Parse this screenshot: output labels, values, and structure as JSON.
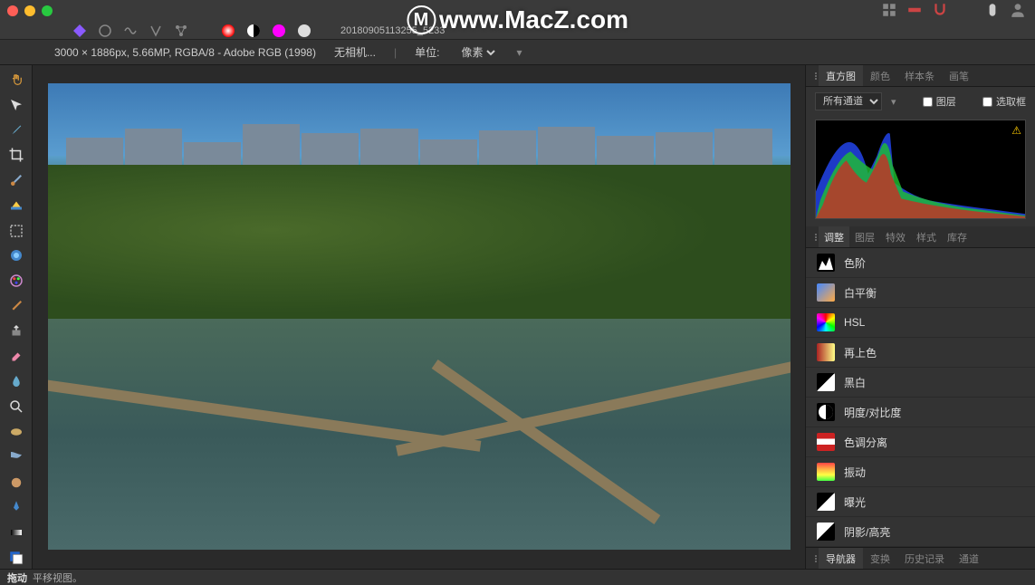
{
  "titlebar": {
    "filename": "20180905113255_5233"
  },
  "infobar": {
    "dimensions": "3000 × 1886px, 5.66MP, RGBA/8 - Adobe RGB (1998)",
    "camera": "无相机...",
    "unit_label": "单位:",
    "unit_value": "像素"
  },
  "watermark": "www.MacZ.com",
  "right_panel": {
    "hist_tabs": [
      "直方图",
      "颜色",
      "样本条",
      "画笔"
    ],
    "hist_tab_active": 0,
    "channel_select": "所有通道",
    "layer_check": "图层",
    "selection_check": "选取框",
    "adjust_tabs": [
      "调整",
      "图层",
      "特效",
      "样式",
      "库存"
    ],
    "adjust_tab_active": 0,
    "adjustments": [
      {
        "label": "色阶",
        "icon": "levels"
      },
      {
        "label": "白平衡",
        "icon": "whitebalance"
      },
      {
        "label": "HSL",
        "icon": "hsl"
      },
      {
        "label": "再上色",
        "icon": "recolor"
      },
      {
        "label": "黑白",
        "icon": "bw"
      },
      {
        "label": "明度/对比度",
        "icon": "brightness"
      },
      {
        "label": "色调分离",
        "icon": "posterize"
      },
      {
        "label": "振动",
        "icon": "vibrance"
      },
      {
        "label": "曝光",
        "icon": "exposure"
      },
      {
        "label": "阴影/高亮",
        "icon": "shadows"
      }
    ],
    "nav_tabs": [
      "导航器",
      "变换",
      "历史记录",
      "通道"
    ],
    "nav_tab_active": 0
  },
  "statusbar": {
    "tool": "拖动",
    "hint": "平移视图。"
  },
  "tools": [
    "hand",
    "move",
    "eyedropper",
    "crop",
    "brush",
    "flood",
    "marquee",
    "inpaint",
    "paint",
    "healing",
    "clone",
    "eraser",
    "smudge",
    "dodge",
    "sponge",
    "redeye",
    "blur",
    "pen",
    "gradient",
    "shape"
  ]
}
